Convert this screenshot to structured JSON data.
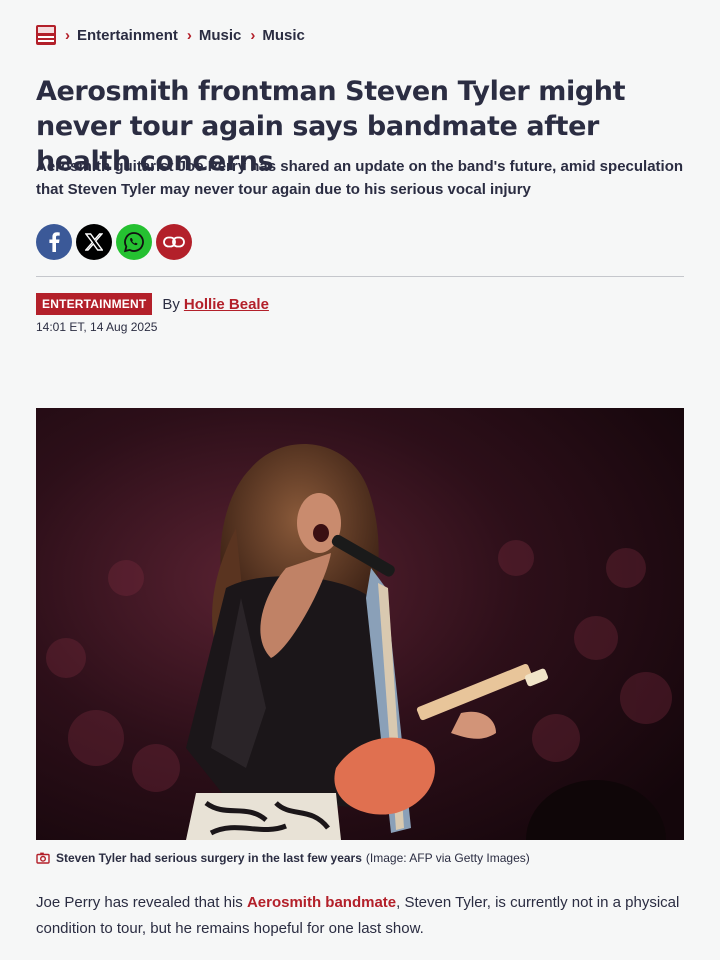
{
  "breadcrumb": {
    "logo_icon": "mirror-logo-icon",
    "separator_icon": "chevron-right-icon",
    "items": [
      "Entertainment",
      "Music",
      "Music"
    ]
  },
  "article": {
    "headline": "Aerosmith frontman Steven Tyler might never tour again says bandmate after health concerns",
    "standfirst": "Aerosmith guitarist Joe Perry has shared an update on the band's future, amid speculation that Steven Tyler may never tour again due to his serious vocal injury",
    "category_badge": "ENTERTAINMENT",
    "by_label": "By",
    "author": "Hollie Beale",
    "timestamp": "14:01 ET, 14 Aug 2025"
  },
  "share": {
    "buttons": [
      {
        "name": "facebook-icon",
        "color": "#3b5998"
      },
      {
        "name": "x-icon",
        "color": "#000000"
      },
      {
        "name": "whatsapp-icon",
        "color": "#25c131"
      },
      {
        "name": "link-icon",
        "color": "#b3202a"
      }
    ]
  },
  "image": {
    "caption": "Steven Tyler had serious surgery in the last few years",
    "credit": "(Image: AFP via Getty Images)",
    "caption_icon": "camera-icon"
  },
  "body": {
    "p1_before": "Joe Perry has revealed that his ",
    "p1_link": "Aerosmith bandmate",
    "p1_after": ", Steven Tyler, is currently not in a physical condition to tour, but he remains hopeful for one last show."
  },
  "colors": {
    "accent": "#b3202a",
    "text": "#2b2d42",
    "background": "#f6f7f7"
  }
}
